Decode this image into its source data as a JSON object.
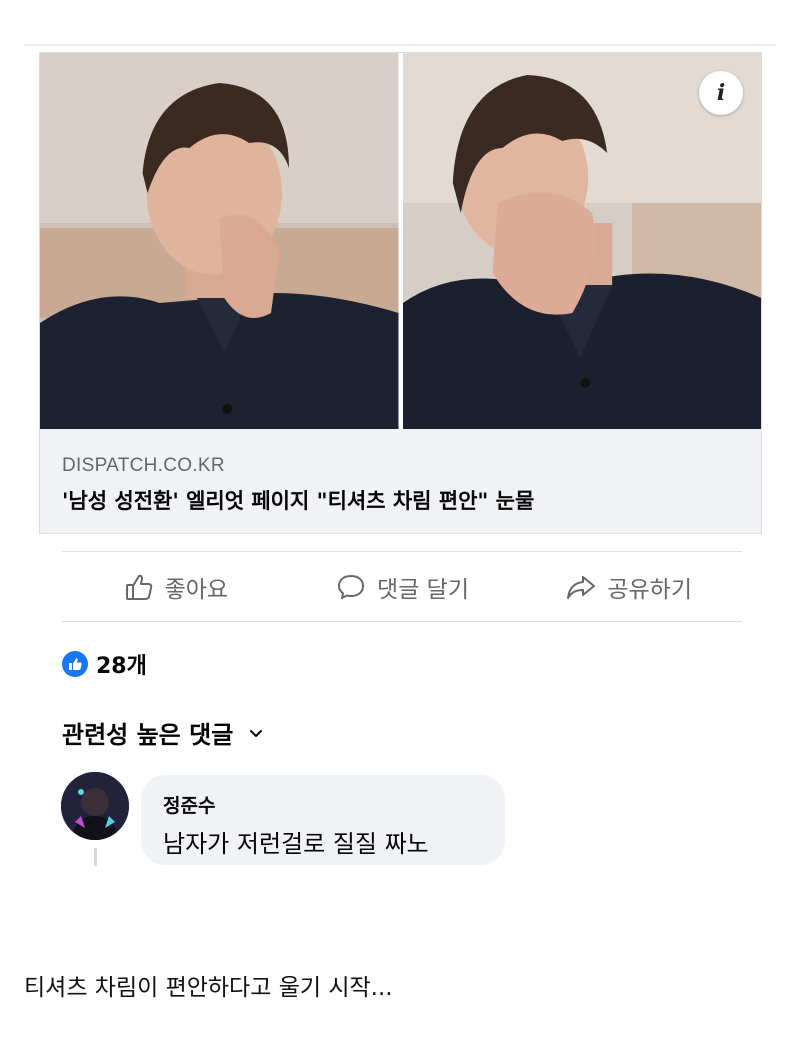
{
  "link_card": {
    "info_icon": "info-icon",
    "domain": "DISPATCH.CO.KR",
    "headline": "'남성 성전환' 엘리엇 페이지 \"티셔츠 차림 편안\" 눈물"
  },
  "actions": {
    "like_label": "좋아요",
    "comment_label": "댓글 달기",
    "share_label": "공유하기"
  },
  "reactions": {
    "count_label": "28개",
    "accent": "#1877f2"
  },
  "comments": {
    "sort_label": "관련성 높은 댓글",
    "items": [
      {
        "author": "정준수",
        "text": "남자가 저런걸로 질질 짜노"
      }
    ]
  },
  "caption": "티셔츠 차림이 편안하다고 울기 시작..."
}
